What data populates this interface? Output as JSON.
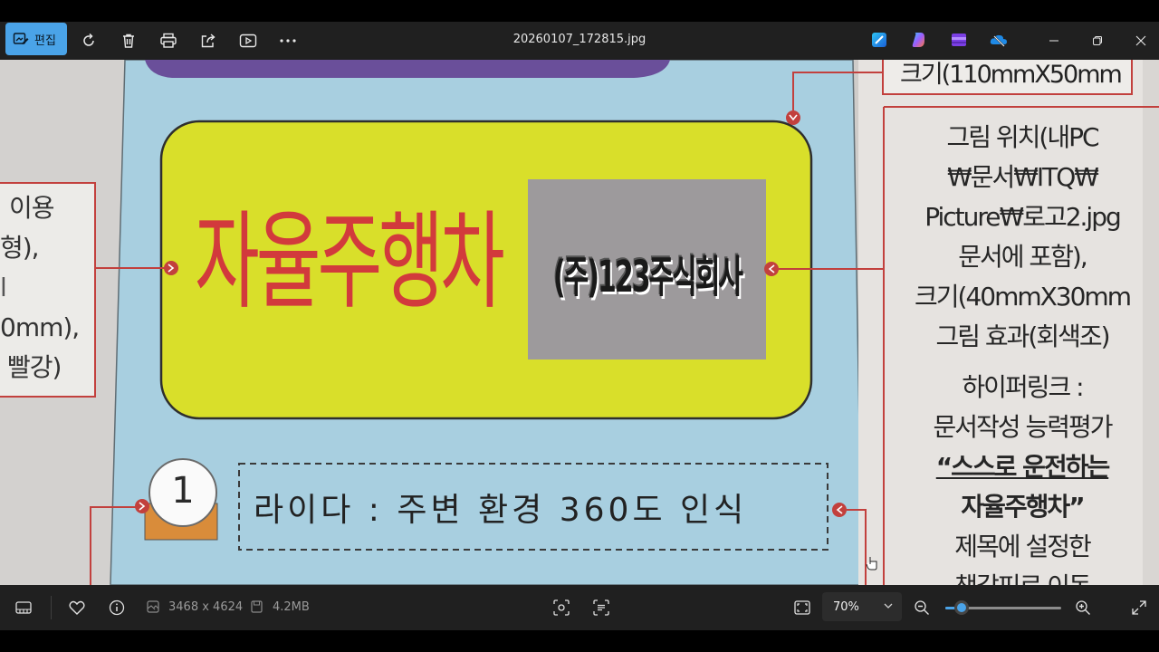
{
  "toolbar": {
    "edit_label": "편집",
    "file_name": "20260107_172815.jpg",
    "icons": [
      "rotate-icon",
      "delete-icon",
      "print-icon",
      "share-icon",
      "slideshow-icon",
      "more-icon"
    ],
    "app_icons": [
      "designer-icon",
      "copilot-icon",
      "clipchamp-icon",
      "onedrive-icon"
    ]
  },
  "photo": {
    "title_left": "자율주행차",
    "logo_text": "(주)123주식회사",
    "item_number": "1",
    "item_text": "라이다 : 주변 환경 360도 인식",
    "left_callout": [
      "이용",
      "형),",
      "l",
      "0mm),",
      "빨강)"
    ],
    "right_top_callout": "크기(110mmX50mm",
    "right_callout": [
      "그림 위치(내PC",
      "₩문서₩ITQ₩",
      "Picture₩로고2.jpg",
      "문서에 포함),",
      "크기(40mmX30mm",
      "그림 효과(회색조)"
    ],
    "right_callout2": [
      "하이퍼링크 :",
      "문서작성 능력평가",
      "“스스로 운전하는",
      "자율주행차”",
      "제목에 설정한",
      "책갈피로 이동"
    ]
  },
  "statusbar": {
    "dimensions": "3468 x 4624",
    "file_size": "4.2MB",
    "zoom": "70%",
    "zoom_fraction": 0.14
  },
  "colors": {
    "accent": "#4aa3e8",
    "chrome": "#202020",
    "page_blue": "#a8cfe0",
    "yellow_box": "#d9df2a",
    "callout_red": "#c2403d"
  }
}
